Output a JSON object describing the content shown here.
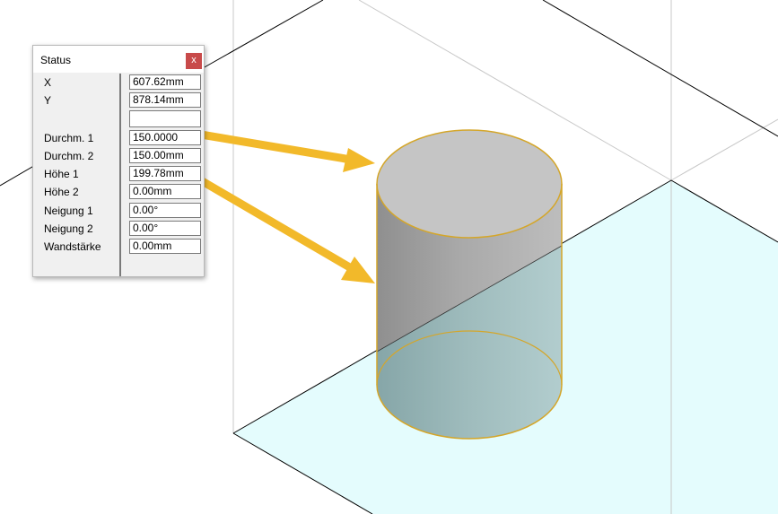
{
  "panel": {
    "title": "Status",
    "close_label": "x",
    "rows": [
      {
        "label": "X",
        "value": "607.62mm"
      },
      {
        "label": "Y",
        "value": "878.14mm"
      },
      {
        "label": "",
        "value": ""
      },
      {
        "label": "Durchm. 1",
        "value": "150.0000"
      },
      {
        "label": "Durchm. 2",
        "value": "150.00mm"
      },
      {
        "label": "Höhe 1",
        "value": "199.78mm"
      },
      {
        "label": "Höhe 2",
        "value": "0.00mm"
      },
      {
        "label": "Neigung 1",
        "value": "0.00°"
      },
      {
        "label": "Neigung 2",
        "value": "0.00°"
      },
      {
        "label": "Wandstärke",
        "value": "0.00mm"
      }
    ]
  },
  "colors": {
    "floor_fill": "#e4fcfd",
    "cylinder_outline": "#d4a62a",
    "arrow": "#f2b92a",
    "close_button": "#c84a4a"
  }
}
